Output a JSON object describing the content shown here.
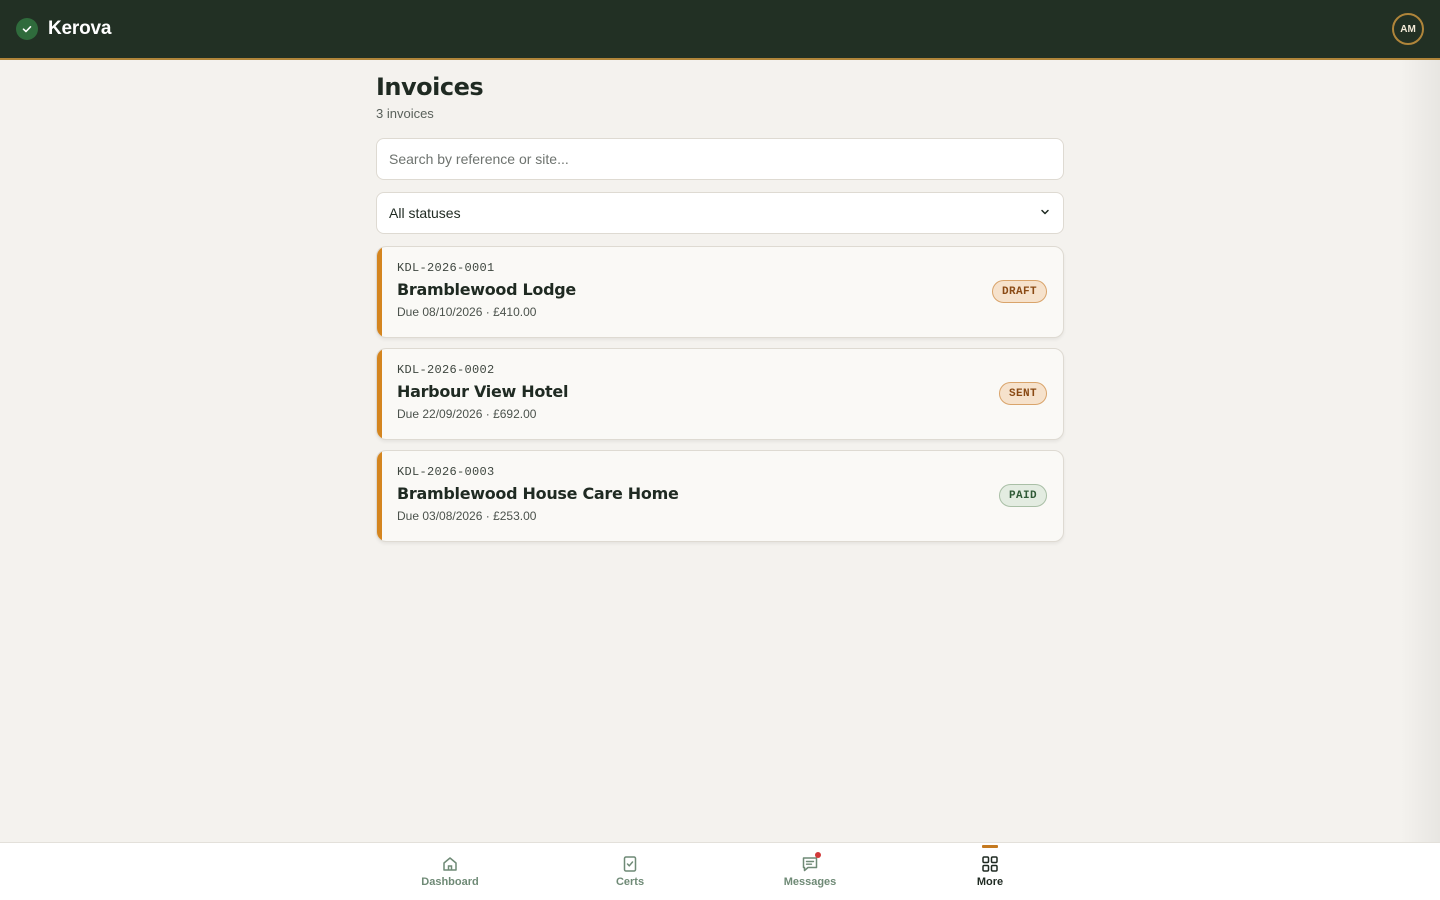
{
  "header": {
    "brand_name": "Kerova",
    "avatar_initials": "AM"
  },
  "page": {
    "title": "Invoices",
    "count_label": "3 invoices"
  },
  "search": {
    "placeholder": "Search by reference or site..."
  },
  "status_filter": {
    "selected": "All statuses"
  },
  "invoices": [
    {
      "reference": "KDL-2026-0001",
      "site": "Bramblewood Lodge",
      "meta": "Due 08/10/2026 · £410.00",
      "status": "DRAFT"
    },
    {
      "reference": "KDL-2026-0002",
      "site": "Harbour View Hotel",
      "meta": "Due 22/09/2026 · £692.00",
      "status": "SENT"
    },
    {
      "reference": "KDL-2026-0003",
      "site": "Bramblewood House Care Home",
      "meta": "Due 03/08/2026 · £253.00",
      "status": "PAID"
    }
  ],
  "bottom_nav": {
    "items": [
      {
        "label": "Dashboard",
        "icon": "home-icon"
      },
      {
        "label": "Certs",
        "icon": "certificate-icon"
      },
      {
        "label": "Messages",
        "icon": "message-icon",
        "has_notification": true
      },
      {
        "label": "More",
        "icon": "grid-icon",
        "active": true
      }
    ]
  },
  "colors": {
    "topbar": "#223024",
    "accent": "#d4851f",
    "background": "#f4f2ee"
  }
}
